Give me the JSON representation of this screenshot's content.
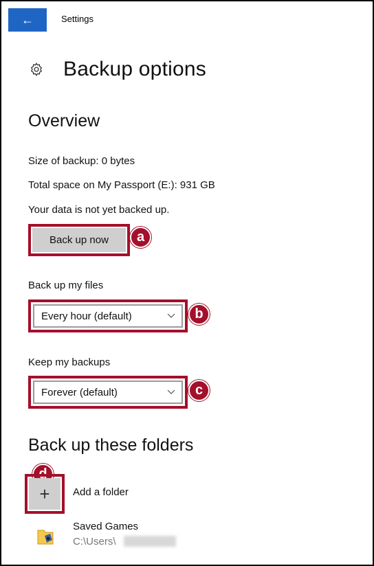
{
  "titlebar": {
    "back_icon": "back-arrow-icon",
    "title": "Settings"
  },
  "page": {
    "icon": "gear-icon",
    "title": "Backup options"
  },
  "overview": {
    "heading": "Overview",
    "size_of_backup": "Size of backup: 0 bytes",
    "total_space": "Total space on My Passport (E:): 931 GB",
    "status": "Your data is not yet backed up.",
    "backup_now_label": "Back up now"
  },
  "backup_frequency": {
    "label": "Back up my files",
    "selected": "Every hour (default)"
  },
  "keep_backups": {
    "label": "Keep my backups",
    "selected": "Forever (default)"
  },
  "folders": {
    "heading": "Back up these folders",
    "add_label": "Add a folder",
    "items": [
      {
        "name": "Saved Games",
        "path": "C:\\Users\\"
      }
    ]
  },
  "callouts": {
    "a": "a",
    "b": "b",
    "c": "c",
    "d": "d"
  },
  "colors": {
    "accent": "#1f66c4",
    "callout": "#a3102b",
    "button_bg": "#cfcfcf"
  }
}
